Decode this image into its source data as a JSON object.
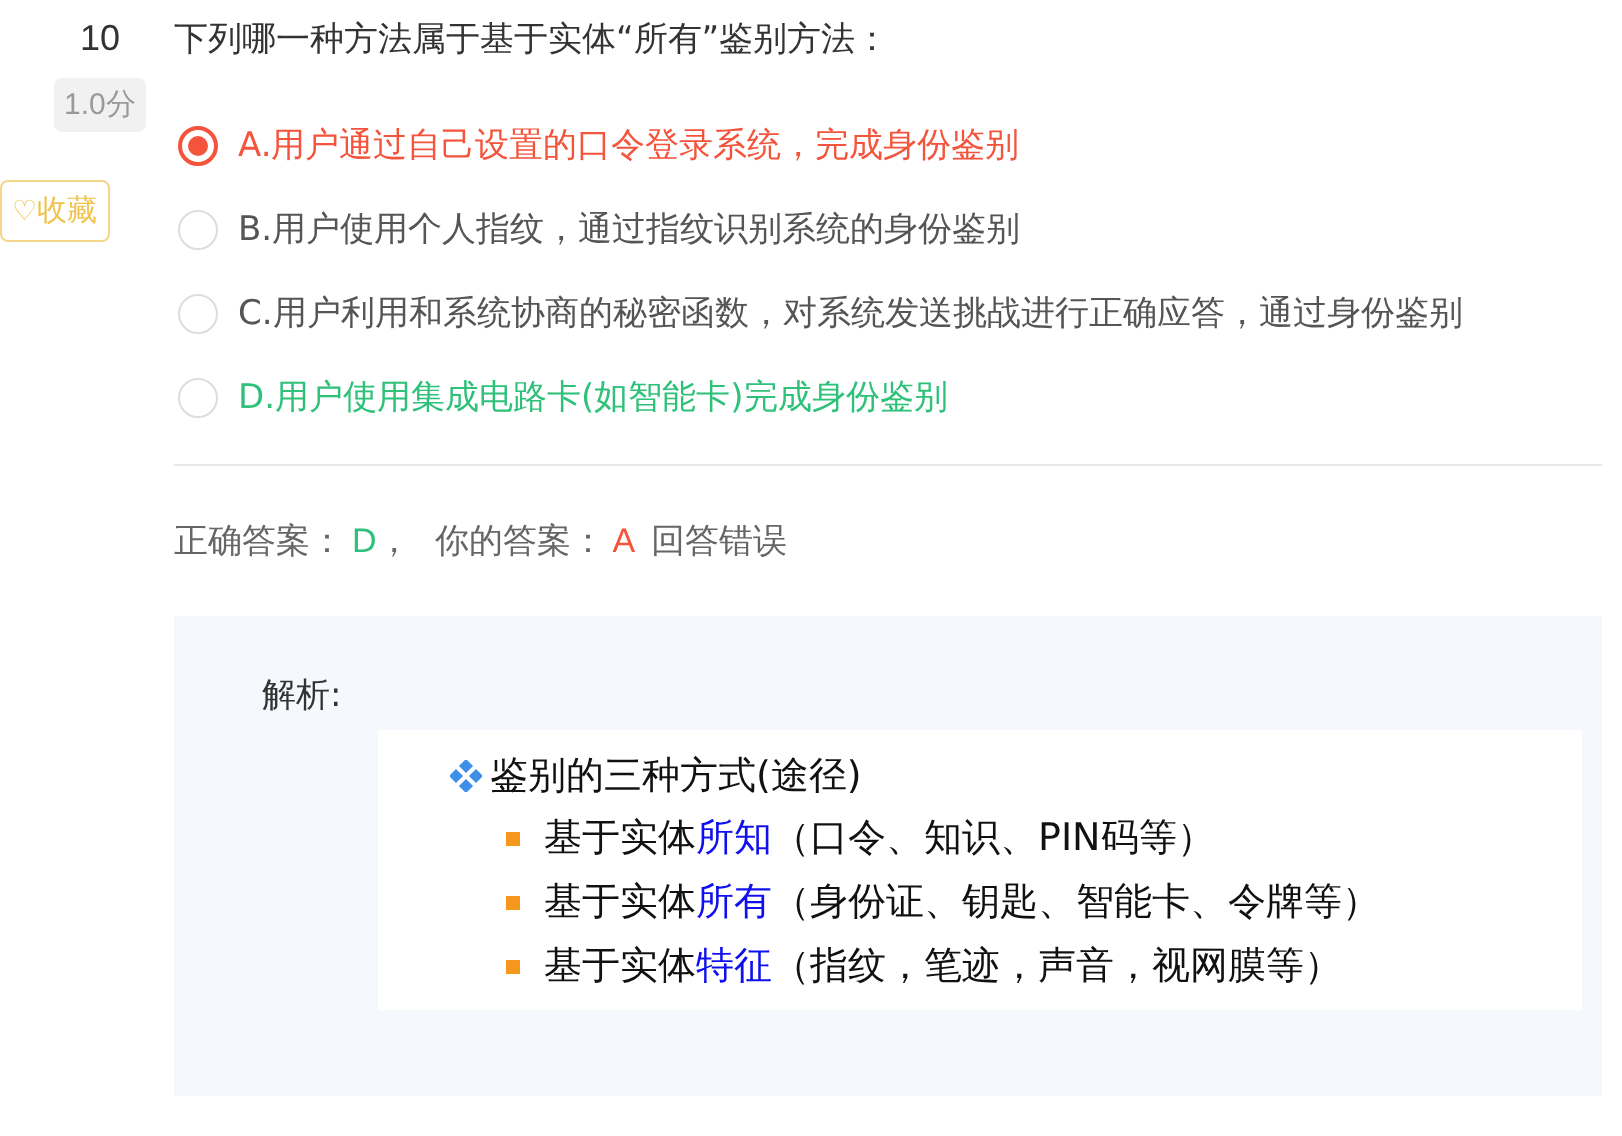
{
  "question": {
    "number": "10",
    "score": "1.0分",
    "favorite": {
      "icon": "♡",
      "label": "收藏"
    },
    "text": "下列哪一种方法属于基于实体“所有”鉴别方法："
  },
  "options": [
    {
      "text": "A.用户通过自己设置的口令登录系统，完成身份鉴别",
      "selected": true,
      "color": "#f5543c"
    },
    {
      "text": "B.用户使用个人指纹，通过指纹识别系统的身份鉴别",
      "selected": false,
      "color": "#555555"
    },
    {
      "text": "C.用户利用和系统协商的秘密函数，对系统发送挑战进行正确应答，通过身份鉴别",
      "selected": false,
      "color": "#555555"
    },
    {
      "text": "D.用户使用集成电路卡(如智能卡)完成身份鉴别",
      "selected": false,
      "color": "#2fc17a"
    }
  ],
  "result": {
    "correct_label": "正确答案：",
    "correct_value": "D",
    "separator": "，",
    "your_label": "你的答案：",
    "your_value": "A",
    "verdict": "回答错误"
  },
  "analysis": {
    "label": "解析:",
    "heading": "鉴别的三种方式(途径)",
    "items": [
      {
        "prefix": "基于实体",
        "highlight": "所知",
        "suffix": "（口令、知识、PIN码等）"
      },
      {
        "prefix": "基于实体",
        "highlight": "所有",
        "suffix": "（身份证、钥匙、智能卡、令牌等）"
      },
      {
        "prefix": "基于实体",
        "highlight": "特征",
        "suffix": "（指纹，笔迹，声音，视网膜等）"
      }
    ]
  }
}
